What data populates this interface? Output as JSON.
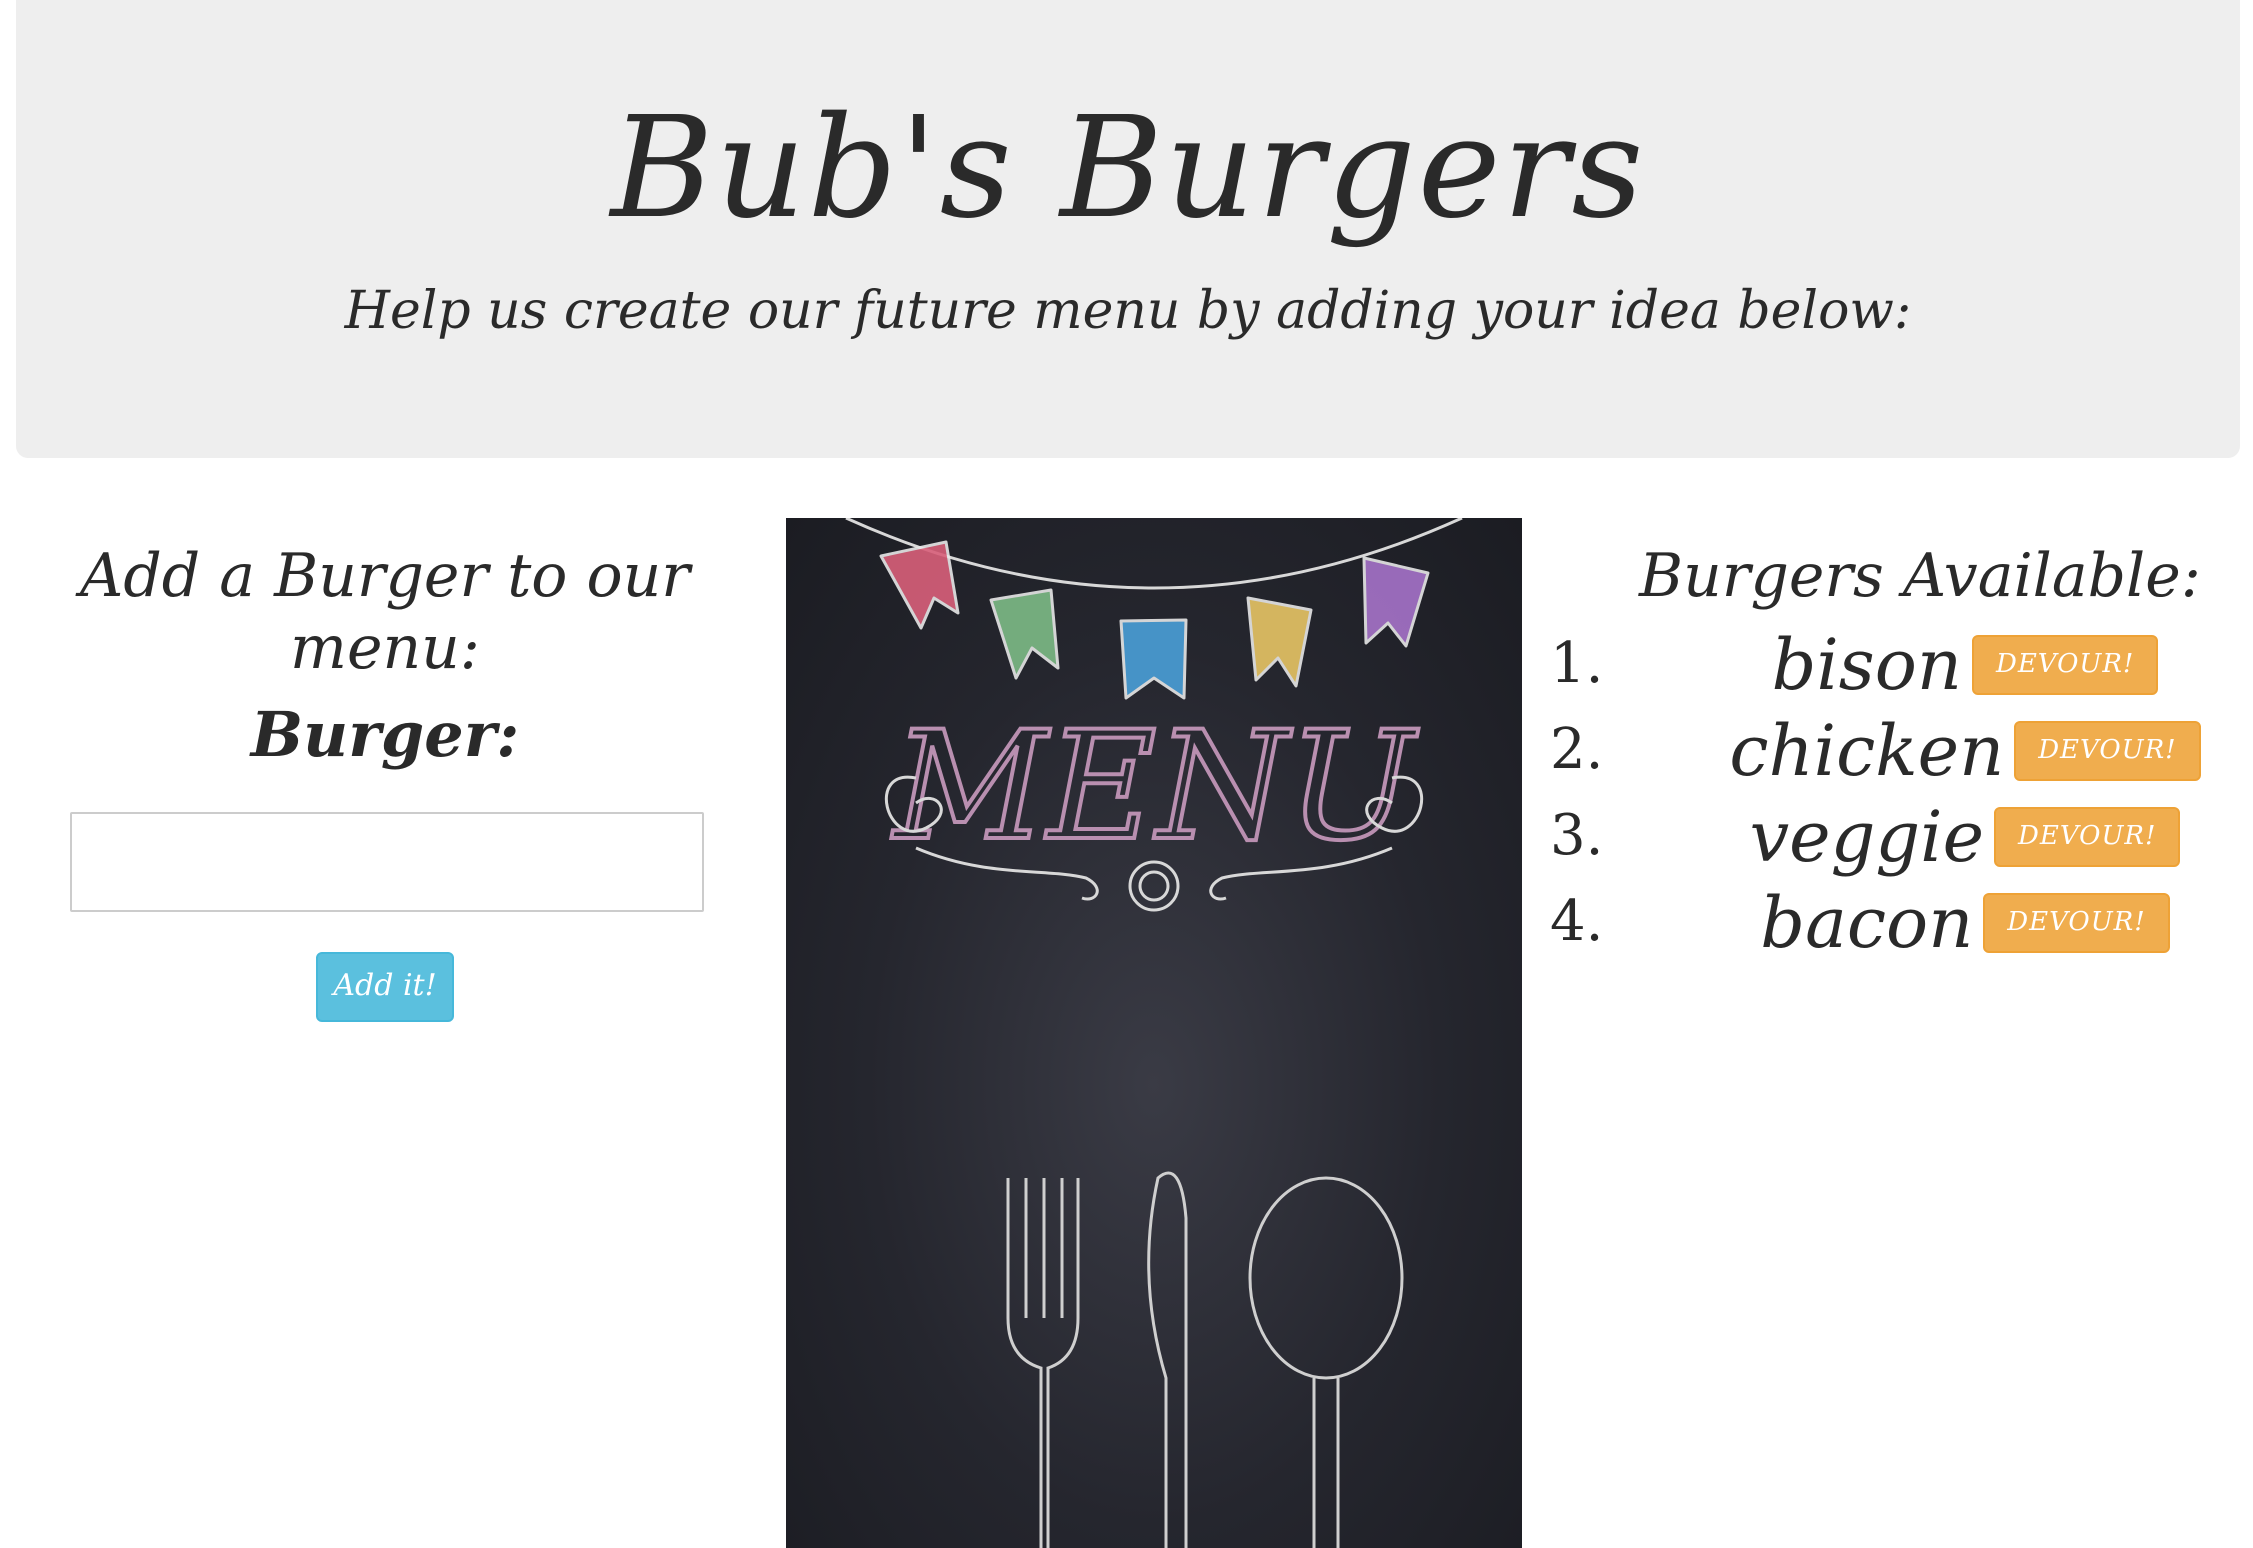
{
  "header": {
    "title": "Bub's Burgers",
    "subtitle": "Help us create our future menu by adding your idea below:"
  },
  "add_form": {
    "heading": "Add a Burger to our menu:",
    "label": "Burger:",
    "input_value": "",
    "submit_label": "Add it!"
  },
  "menu_image": {
    "board_text": "MENU",
    "colors": {
      "flag_1": "#d9607a",
      "flag_2": "#7dbb86",
      "flag_3": "#4a9fd8",
      "flag_4": "#e8c565",
      "flag_5": "#a673c9"
    }
  },
  "burgers": {
    "heading": "Burgers Available:",
    "items": [
      {
        "number": "1.",
        "name": "bison",
        "action": "DEVOUR!"
      },
      {
        "number": "2.",
        "name": "chicken",
        "action": "DEVOUR!"
      },
      {
        "number": "3.",
        "name": "veggie",
        "action": "DEVOUR!"
      },
      {
        "number": "4.",
        "name": "bacon",
        "action": "DEVOUR!"
      }
    ]
  },
  "theme": {
    "jumbotron_bg": "#eeeeee",
    "info_button": "#5bc0de",
    "warning_button": "#f0ad4e"
  }
}
